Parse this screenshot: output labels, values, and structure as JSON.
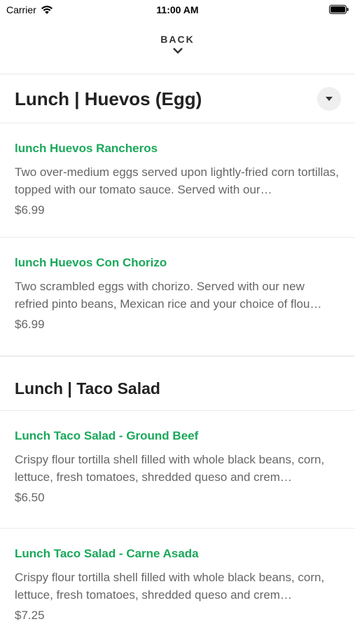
{
  "status_bar": {
    "carrier": "Carrier",
    "time": "11:00 AM"
  },
  "header": {
    "back_label": "BACK"
  },
  "sections": [
    {
      "title": "Lunch | Huevos (Egg)",
      "items": [
        {
          "name": "lunch Huevos Rancheros",
          "description": "Two over-medium eggs served upon lightly-fried corn tortillas, topped with our tomato sauce. Served with our…",
          "price": "$6.99"
        },
        {
          "name": "lunch Huevos Con Chorizo",
          "description": "Two scrambled eggs with chorizo. Served with our new refried pinto beans, Mexican rice and your choice of flou…",
          "price": "$6.99"
        }
      ]
    },
    {
      "title": "Lunch | Taco Salad",
      "items": [
        {
          "name": "Lunch Taco Salad - Ground Beef",
          "description": "Crispy flour tortilla shell filled with whole black beans, corn, lettuce, fresh tomatoes, shredded queso and crem…",
          "price": "$6.50"
        },
        {
          "name": "Lunch Taco Salad - Carne Asada",
          "description": "Crispy flour tortilla shell filled with whole black beans, corn, lettuce, fresh tomatoes, shredded queso and crem…",
          "price": "$7.25"
        }
      ]
    }
  ],
  "colors": {
    "item_name": "#1aa85a",
    "text": "#222222",
    "muted": "#666666"
  },
  "icons": {
    "wifi": "wifi-icon",
    "battery": "battery-icon",
    "back": "chevron-down-icon",
    "dropdown": "caret-down-icon"
  }
}
